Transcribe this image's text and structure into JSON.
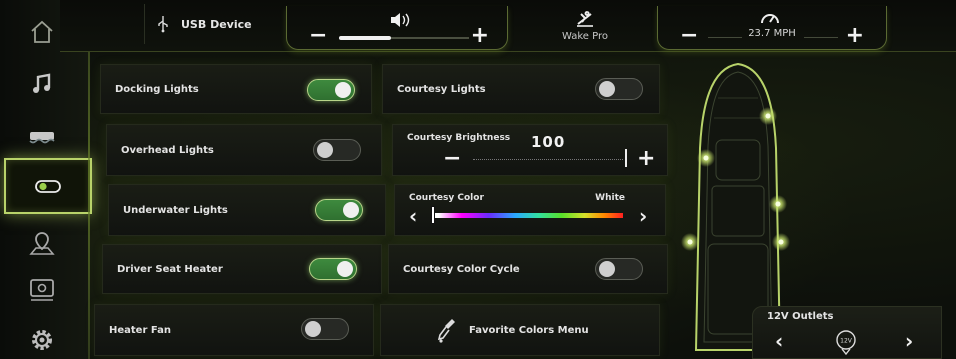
{
  "sidebar": {
    "items": [
      {
        "name": "home-icon",
        "active": false
      },
      {
        "name": "music-note-icon",
        "active": false
      },
      {
        "name": "boat-hull-icon",
        "active": false
      },
      {
        "name": "toggle-lights-icon",
        "active": true
      },
      {
        "name": "map-pin-icon",
        "active": false
      },
      {
        "name": "camera-icon",
        "active": false
      },
      {
        "name": "gear-icon",
        "active": false
      }
    ]
  },
  "topbar": {
    "usb_label": "USB Device",
    "volume": {
      "minus": "−",
      "plus": "+",
      "level": 0.4
    },
    "wake_label": "Wake Pro",
    "speed": {
      "minus": "−",
      "plus": "+",
      "value": "23.7 MPH"
    }
  },
  "panels": {
    "docking_lights": {
      "label": "Docking Lights",
      "on": true
    },
    "overhead_lights": {
      "label": "Overhead Lights",
      "on": false
    },
    "underwater_lights": {
      "label": "Underwater Lights",
      "on": true
    },
    "driver_seat_heater": {
      "label": "Driver Seat Heater",
      "on": true
    },
    "heater_fan": {
      "label": "Heater Fan",
      "on": false
    },
    "courtesy_lights": {
      "label": "Courtesy Lights",
      "on": false
    },
    "courtesy_brightness": {
      "label": "Courtesy Brightness",
      "value": "100",
      "minus": "−",
      "plus": "+"
    },
    "courtesy_color": {
      "label": "Courtesy Color",
      "value": "White",
      "prev": "‹",
      "next": "›"
    },
    "courtesy_color_cycle": {
      "label": "Courtesy Color Cycle",
      "on": false
    },
    "favorite_colors": {
      "label": "Favorite Colors Menu"
    }
  },
  "outlets": {
    "label": "12V Outlets",
    "icon_text": "12V",
    "prev": "‹",
    "next": "›"
  },
  "colors": {
    "accent": "#b9d36a",
    "toggle_on": "#3e8a3e",
    "panel_bg": "#1a1d15"
  }
}
